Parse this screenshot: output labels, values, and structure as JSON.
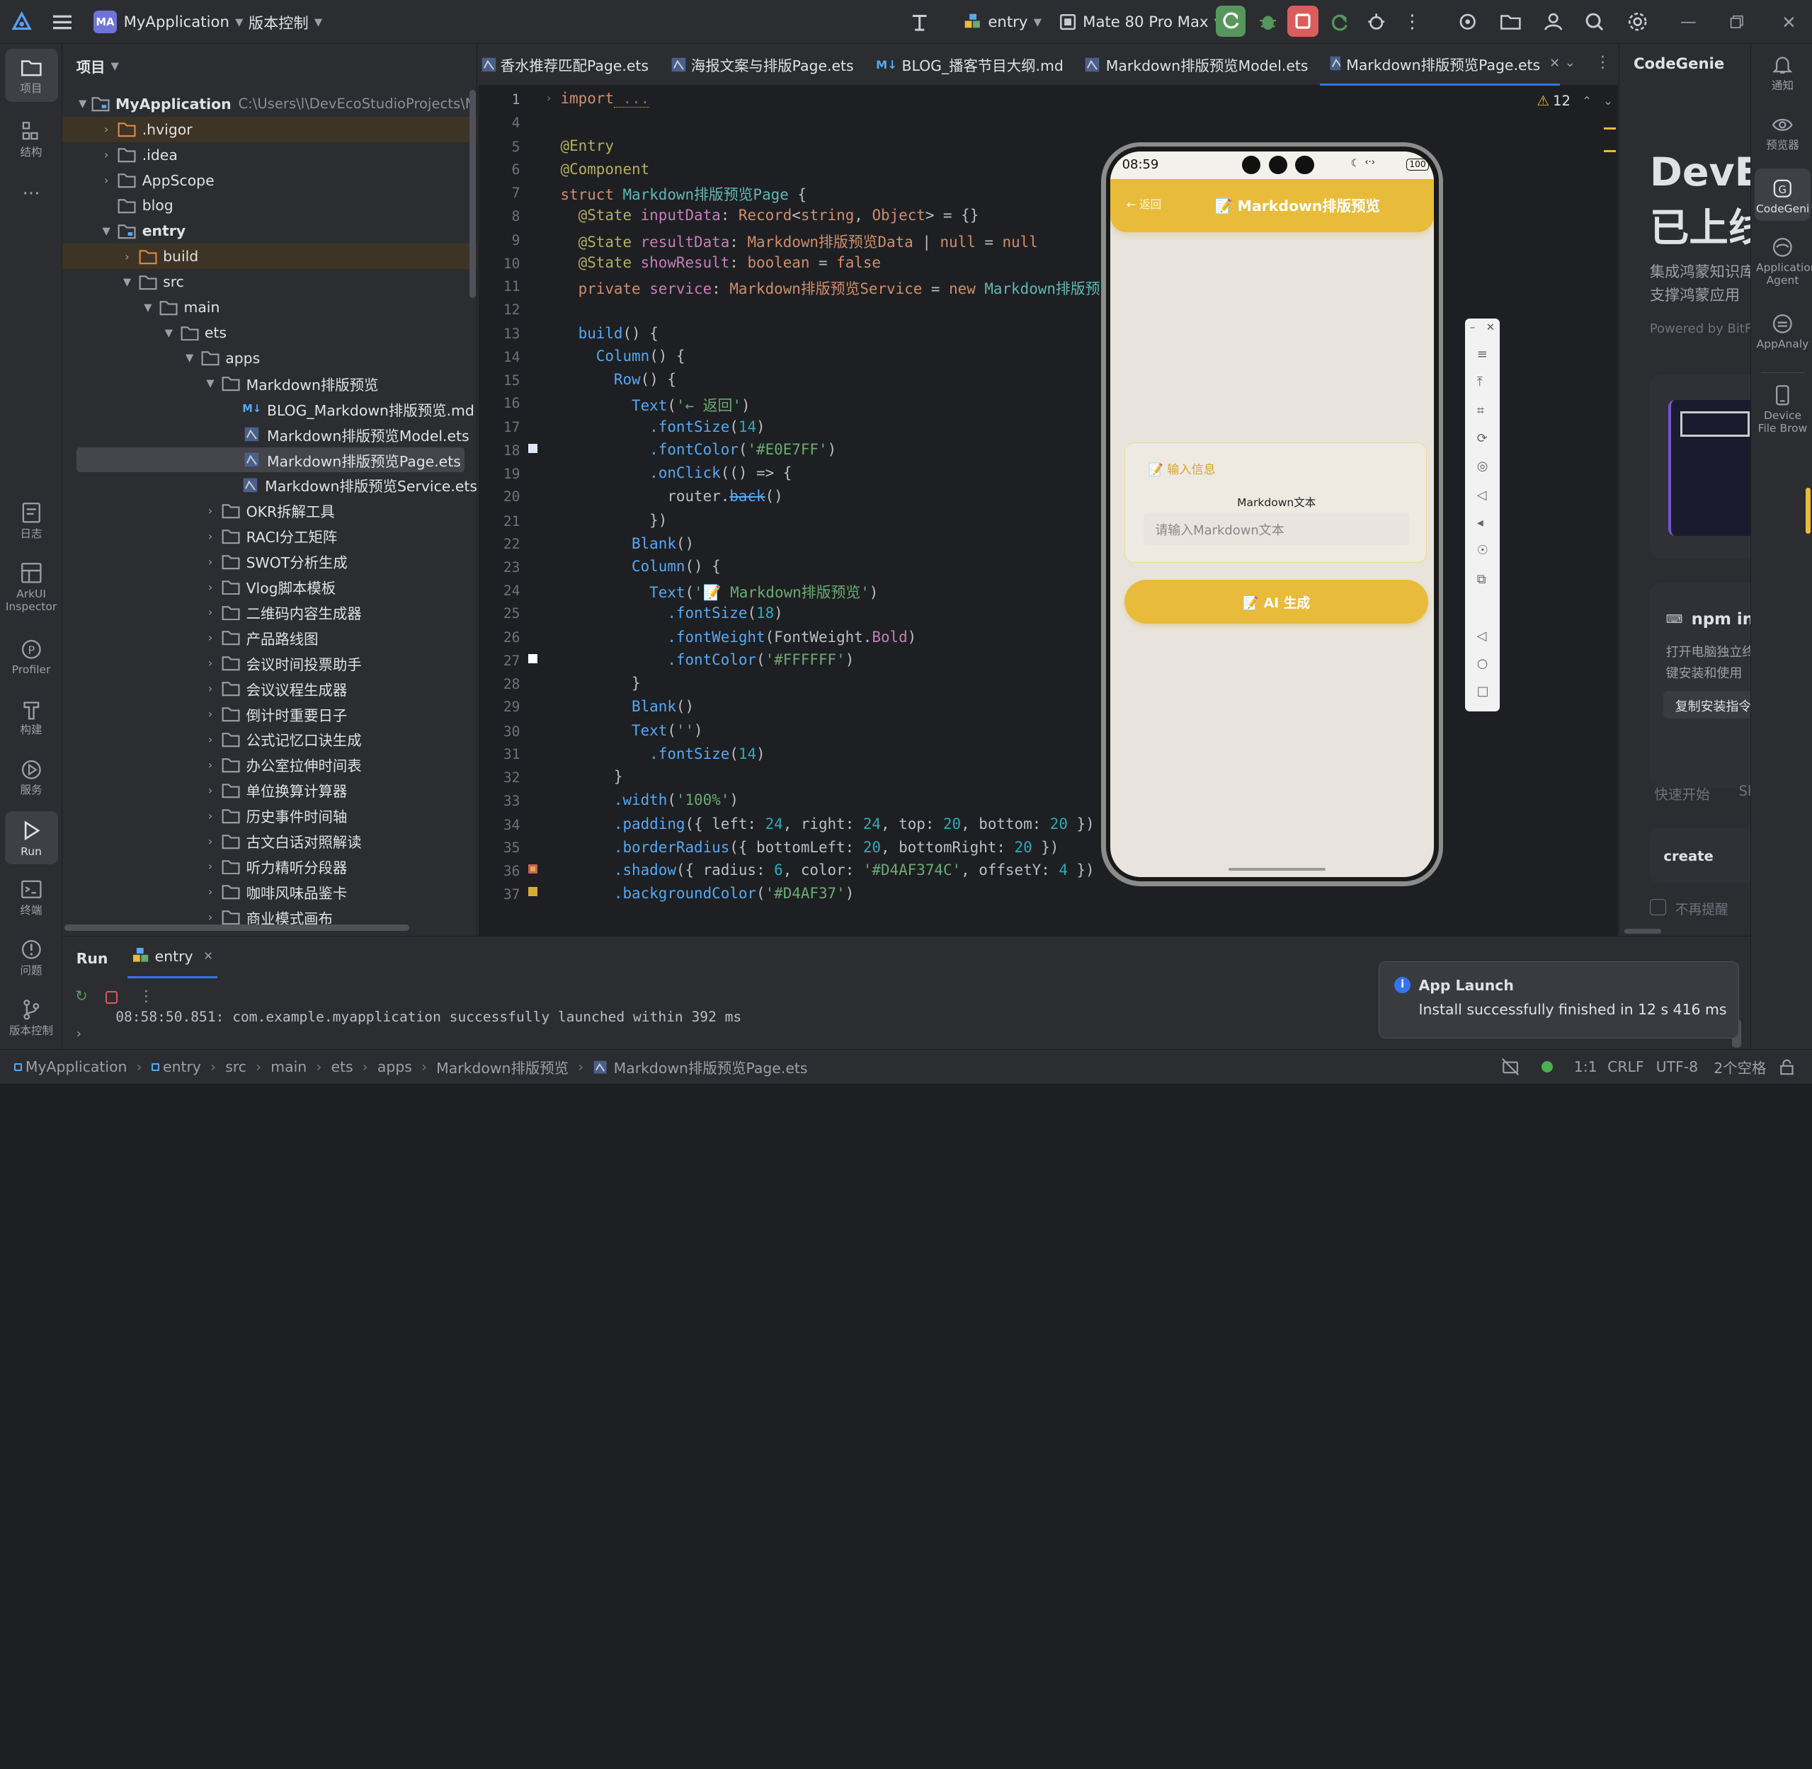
{
  "titlebar": {
    "project_badge": "MA",
    "project_name": "MyApplication",
    "vcs": "版本控制",
    "run_config": "entry",
    "device": "Mate 80 Pro Max"
  },
  "left_tools": [
    {
      "label": "项目"
    },
    {
      "label": "结构"
    },
    {
      "label": "日志"
    },
    {
      "label": "ArkUI Inspector"
    },
    {
      "label": "Profiler"
    },
    {
      "label": "构建"
    },
    {
      "label": "服务"
    },
    {
      "label": "Run"
    },
    {
      "label": "终端"
    },
    {
      "label": "问题"
    },
    {
      "label": "版本控制"
    }
  ],
  "project": {
    "header": "项目",
    "root_name": "MyApplication",
    "root_path": "C:\\Users\\l\\DevEcoStudioProjects\\MyApplica",
    "rows": [
      {
        "label": ".hvigor"
      },
      {
        "label": ".idea"
      },
      {
        "label": "AppScope"
      },
      {
        "label": "blog"
      },
      {
        "label": "entry"
      },
      {
        "label": "build"
      },
      {
        "label": "src"
      },
      {
        "label": "main"
      },
      {
        "label": "ets"
      },
      {
        "label": "apps"
      },
      {
        "label": "Markdown排版预览"
      },
      {
        "label": "BLOG_Markdown排版预览.md"
      },
      {
        "label": "Markdown排版预览Model.ets"
      },
      {
        "label": "Markdown排版预览Page.ets"
      },
      {
        "label": "Markdown排版预览Service.ets"
      },
      {
        "label": "OKR拆解工具"
      },
      {
        "label": "RACI分工矩阵"
      },
      {
        "label": "SWOT分析生成"
      },
      {
        "label": "Vlog脚本模板"
      },
      {
        "label": "二维码内容生成器"
      },
      {
        "label": "产品路线图"
      },
      {
        "label": "会议时间投票助手"
      },
      {
        "label": "会议议程生成器"
      },
      {
        "label": "倒计时重要日子"
      },
      {
        "label": "公式记忆口诀生成"
      },
      {
        "label": "办公室拉伸时间表"
      },
      {
        "label": "单位换算计算器"
      },
      {
        "label": "历史事件时间轴"
      },
      {
        "label": "古文白话对照解读"
      },
      {
        "label": "听力精听分段器"
      },
      {
        "label": "咖啡风味品鉴卡"
      },
      {
        "label": "商业模式画布"
      }
    ]
  },
  "tabs": [
    {
      "label": "香水推荐匹配Page.ets"
    },
    {
      "label": "海报文案与排版Page.ets"
    },
    {
      "label": "BLOG_播客节目大纲.md"
    },
    {
      "label": "Markdown排版预览Model.ets"
    },
    {
      "label": "Markdown排版预览Page.ets"
    }
  ],
  "editor": {
    "warnings": "12",
    "line_numbers": [
      "1",
      "4",
      "5",
      "6",
      "7",
      "8",
      "9",
      "10",
      "11",
      "12",
      "13",
      "14",
      "15",
      "16",
      "17",
      "18",
      "19",
      "20",
      "21",
      "22",
      "23",
      "24",
      "25",
      "26",
      "27",
      "28",
      "29",
      "30",
      "31",
      "32",
      "33",
      "34",
      "35",
      "36",
      "37"
    ],
    "code": {
      "l1_kw": "import",
      "l1_rest": " ...",
      "l5": "@Entry",
      "l6": "@Component",
      "l7_kw": "struct",
      "l7_name": " Markdown排版预览Page",
      "l7_rest": " {",
      "l8_an": "  @State",
      "l8_a": " inputData",
      "l8_b": ": ",
      "l8_ty": "Record",
      "l8_c": "<",
      "l8_d": "string",
      "l8_e": ", ",
      "l8_f": "Object",
      "l8_g": "> = {}",
      "l9_an": "  @State",
      "l9_a": " resultData",
      "l9_b": ": ",
      "l9_ty": "Markdown排版预览Data",
      "l9_c": " | ",
      "l9_d": "null",
      "l9_e": " = ",
      "l9_f": "null",
      "l10_an": "  @State",
      "l10_a": " showResult",
      "l10_b": ": ",
      "l10_ty": "boolean",
      "l10_c": " = ",
      "l10_d": "false",
      "l11_kw": "  private",
      "l11_a": " service",
      "l11_b": ": ",
      "l11_ty": "Markdown排版预览Service",
      "l11_c": " = ",
      "l11_d": "new",
      "l11_e": " Markdown排版预览Se",
      "l13_fn": "  build",
      "l13_rest": "() {",
      "l14_fn": "    Column",
      "l14_rest": "() {",
      "l15_fn": "      Row",
      "l15_rest": "() {",
      "l16_fn": "        Text",
      "l16_a": "(",
      "l16_st": "'← 返回'",
      "l16_b": ")",
      "l17_fn": "          .fontSize",
      "l17_a": "(",
      "l17_nm": "14",
      "l17_b": ")",
      "l18_fn": "          .fontColor",
      "l18_a": "(",
      "l18_st": "'#E0E7FF'",
      "l18_b": ")",
      "l19_fn": "          .onClick",
      "l19_a": "(() => {",
      "l20_a": "            router.",
      "l20_fn": "back",
      "l20_b": "()",
      "l21": "          })",
      "l22_fn": "        Blank",
      "l22_a": "()",
      "l23_fn": "        Column",
      "l23_a": "() {",
      "l24_fn": "          Text",
      "l24_a": "(",
      "l24_st": "'📝 Markdown排版预览'",
      "l24_b": ")",
      "l25_fn": "            .fontSize",
      "l25_a": "(",
      "l25_nm": "18",
      "l25_b": ")",
      "l26_fn": "            .fontWeight",
      "l26_a": "(FontWeight.",
      "l26_b": "Bold",
      "l26_c": ")",
      "l27_fn": "            .fontColor",
      "l27_a": "(",
      "l27_st": "'#FFFFFF'",
      "l27_b": ")",
      "l28": "        }",
      "l29_fn": "        Blank",
      "l29_a": "()",
      "l30_fn": "        Text",
      "l30_a": "(",
      "l30_st": "''",
      "l30_b": ")",
      "l31_fn": "          .fontSize",
      "l31_a": "(",
      "l31_nm": "14",
      "l31_b": ")",
      "l32": "      }",
      "l33_fn": "      .width",
      "l33_a": "(",
      "l33_st": "'100%'",
      "l33_b": ")",
      "l34_fn": "      .padding",
      "l34_a": "({ left: ",
      "l34_n1": "24",
      "l34_b": ", right: ",
      "l34_n2": "24",
      "l34_c": ", top: ",
      "l34_n3": "20",
      "l34_d": ", bottom: ",
      "l34_n4": "20",
      "l34_e": " })",
      "l35_fn": "      .borderRadius",
      "l35_a": "({ bottomLeft: ",
      "l35_n1": "20",
      "l35_b": ", bottomRight: ",
      "l35_n2": "20",
      "l35_c": " })",
      "l36_fn": "      .shadow",
      "l36_a": "({ radius: ",
      "l36_n1": "6",
      "l36_b": ", color: ",
      "l36_st": "'#D4AF374C'",
      "l36_c": ", offsetY: ",
      "l36_n2": "4",
      "l36_d": " })",
      "l37_fn": "      .backgroundColor",
      "l37_a": "(",
      "l37_st": "'#D4AF37'",
      "l37_b": ")"
    }
  },
  "phone": {
    "time": "08:59",
    "battery": "100",
    "back": "← 返回",
    "title": "📝 Markdown排版预览",
    "card_title": "输入信息",
    "field_label": "Markdown文本",
    "placeholder": "请输入Markdown文本",
    "generate": "AI 生成",
    "accent": "#E8BC3A"
  },
  "codegenie": {
    "title": "CodeGenie",
    "hero1": "DevEc",
    "hero2": "已上线",
    "desc1": "集成鸿蒙知识库",
    "desc2": "支撑鸿蒙应用",
    "powered": "Powered by BitFu",
    "npm_title": "npm ins",
    "npm_desc1": "打开电脑独立终",
    "npm_desc2": "键安装和使用",
    "copy_btn": "复制安装指令",
    "quick1": "快速开始",
    "quick2": "Sk",
    "create": "create",
    "noremind": "不再提醒"
  },
  "right_tools": [
    {
      "label": "通知"
    },
    {
      "label": "预览器"
    },
    {
      "label": "CodeGenie"
    },
    {
      "label": "Application Agent"
    },
    {
      "label": "AppAnaly"
    },
    {
      "label": "Device File Brow"
    }
  ],
  "run": {
    "tab_run": "Run",
    "tab_entry": "entry",
    "log": "08:58:50.851: com.example.myapplication successfully launched within 392 ms"
  },
  "toast": {
    "title": "App Launch",
    "message": "Install successfully finished in 12 s 416 ms"
  },
  "status": {
    "breadcrumb": [
      "MyApplication",
      "entry",
      "src",
      "main",
      "ets",
      "apps",
      "Markdown排版预览",
      "Markdown排版预览Page.ets"
    ],
    "pos": "1:1",
    "eol": "CRLF",
    "enc": "UTF-8",
    "indent": "2个空格"
  }
}
